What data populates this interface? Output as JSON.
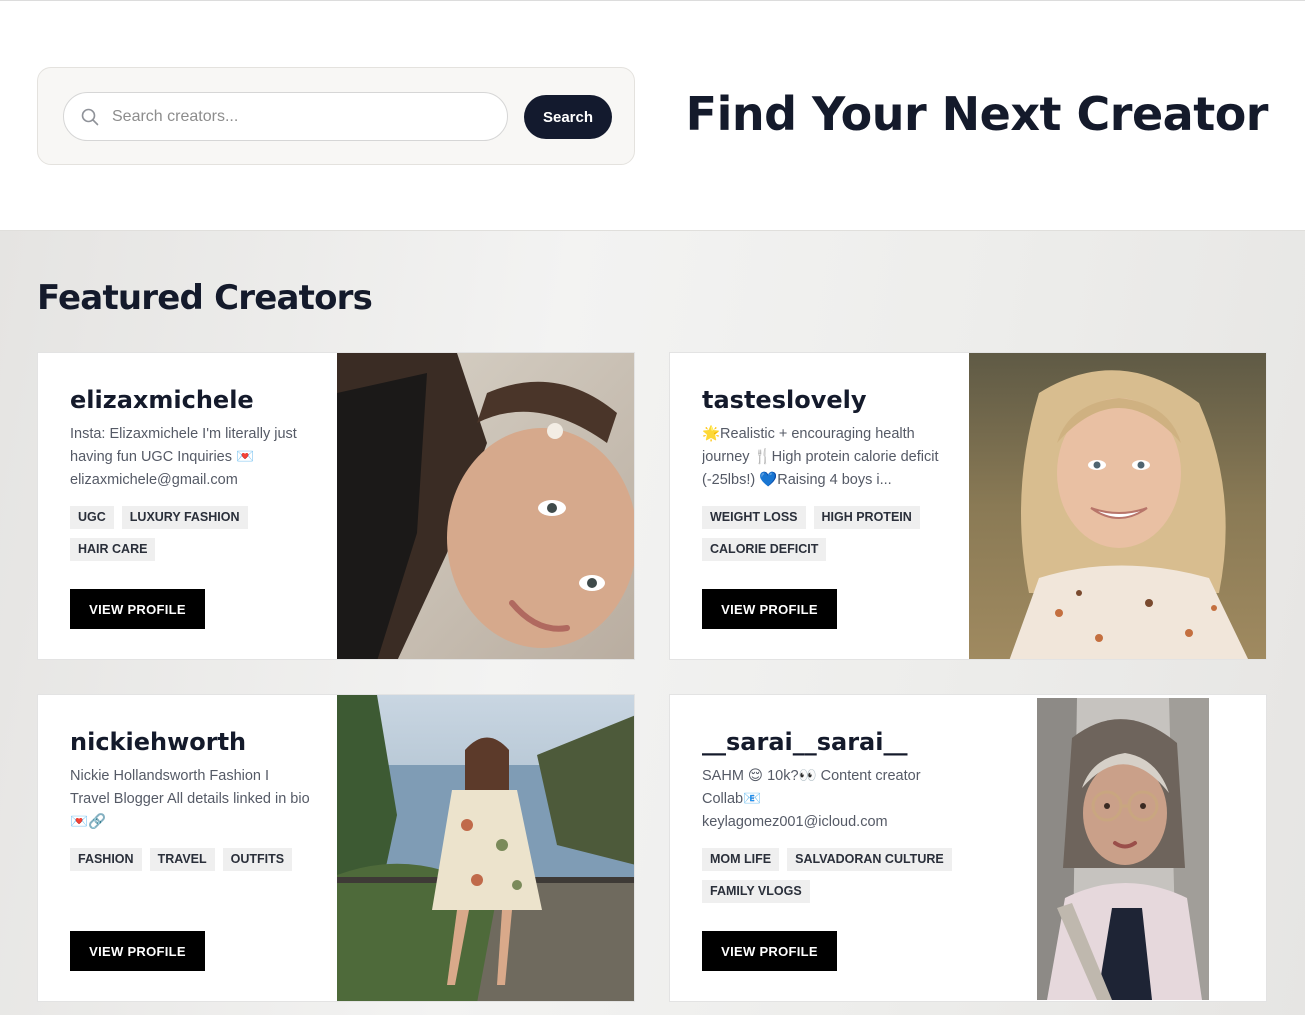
{
  "search": {
    "placeholder": "Search creators...",
    "button_label": "Search"
  },
  "hero": {
    "title": "Find Your Next Creator"
  },
  "featured": {
    "heading": "Featured Creators",
    "creators": [
      {
        "username": "elizaxmichele",
        "bio": "Insta: Elizaxmichele I'm literally just having fun UGC Inquiries 💌 elizaxmichele@gmail.com",
        "tags": [
          "UGC",
          "LUXURY FASHION",
          "HAIR CARE"
        ],
        "button_label": "VIEW PROFILE"
      },
      {
        "username": "tasteslovely",
        "bio": "🌟Realistic + encouraging health journey 🍴High protein calorie deficit (-25lbs!) 💙Raising 4 boys i...",
        "tags": [
          "WEIGHT LOSS",
          "HIGH PROTEIN",
          "CALORIE DEFICIT"
        ],
        "button_label": "VIEW PROFILE"
      },
      {
        "username": "nickiehworth",
        "bio": "Nickie Hollandsworth Fashion I Travel Blogger All details linked in bio 💌🔗",
        "tags": [
          "FASHION",
          "TRAVEL",
          "OUTFITS"
        ],
        "button_label": "VIEW PROFILE"
      },
      {
        "username": "__sarai__sarai__",
        "bio": "SAHM 😌 10k?👀 Content creator Collab📧 keylagomez001@icloud.com",
        "tags": [
          "MOM LIFE",
          "SALVADORAN CULTURE",
          "FAMILY VLOGS"
        ],
        "button_label": "VIEW PROFILE"
      }
    ]
  }
}
